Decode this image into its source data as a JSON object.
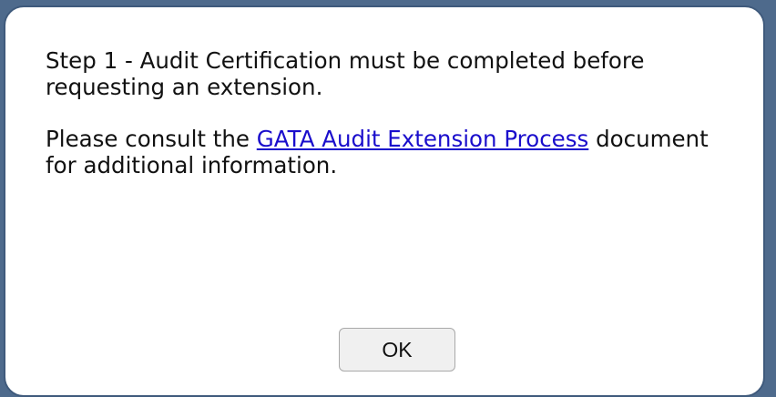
{
  "dialog": {
    "message_line": "Step 1 - Audit Certification must be completed before requesting an extension.",
    "consult_prefix": "Please consult the ",
    "link_text": "GATA Audit Extension Process",
    "consult_suffix": " document for additional information.",
    "ok_label": "OK"
  }
}
